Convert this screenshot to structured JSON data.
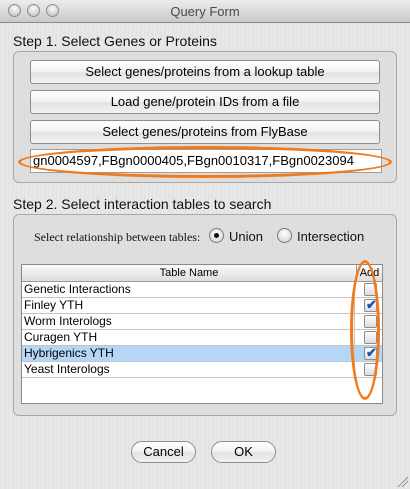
{
  "window": {
    "title": "Query Form"
  },
  "step1": {
    "label": "Step 1. Select Genes or Proteins",
    "buttons": [
      "Select genes/proteins from a lookup table",
      "Load gene/protein IDs from a file",
      "Select genes/proteins from FlyBase"
    ],
    "ids_value": "gn0004597,FBgn0000405,FBgn0010317,FBgn0023094"
  },
  "step2": {
    "label": "Step 2. Select interaction tables to search",
    "relationship_label": "Select relationship between tables:",
    "options": {
      "union": "Union",
      "intersection": "Intersection"
    },
    "selected": "Union",
    "table": {
      "headers": {
        "name": "Table Name",
        "add": "Add"
      },
      "rows": [
        {
          "name": "Genetic Interactions",
          "checked": false,
          "selected": false
        },
        {
          "name": "Finley YTH",
          "checked": true,
          "selected": false
        },
        {
          "name": "Worm Interologs",
          "checked": false,
          "selected": false
        },
        {
          "name": "Curagen YTH",
          "checked": false,
          "selected": false
        },
        {
          "name": "Hybrigenics YTH",
          "checked": true,
          "selected": true
        },
        {
          "name": "Yeast Interologs",
          "checked": false,
          "selected": false
        }
      ]
    }
  },
  "footer": {
    "cancel": "Cancel",
    "ok": "OK"
  },
  "colors": {
    "highlight_oval": "#f07a1c",
    "selected_row": "#b6d6f7",
    "check": "#1a4fb4"
  }
}
